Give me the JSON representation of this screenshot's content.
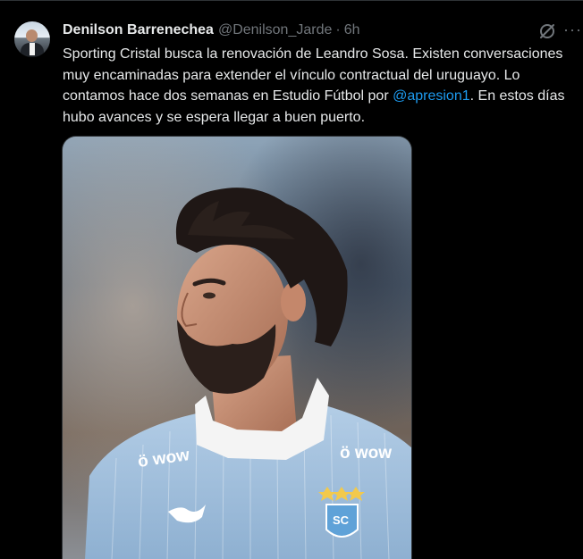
{
  "tweet": {
    "author_name": "Denilson Barrenechea",
    "author_handle": "@Denilson_Jarde",
    "separator": "·",
    "time": "6h",
    "text_before": "Sporting Cristal busca la renovación de Leandro Sosa. Existen conversaciones muy encaminadas para extender el vínculo contractual del uruguayo. Lo contamos hace dos semanas en Estudio Fútbol por ",
    "mention": "@apresion1",
    "text_after": ". En estos días hubo avances y se espera llegar a buen puerto.",
    "more_label": "···"
  },
  "media": {
    "sponsor_left": "ö wow",
    "sponsor_right": "ö wow",
    "crest_text": "SC"
  },
  "icons": {
    "grok": "grok-icon",
    "more": "more-icon"
  },
  "colors": {
    "background": "#000000",
    "text": "#e7e9ea",
    "secondary": "#71767b",
    "link": "#1d9bf0",
    "jersey": "#a9c6e2"
  }
}
